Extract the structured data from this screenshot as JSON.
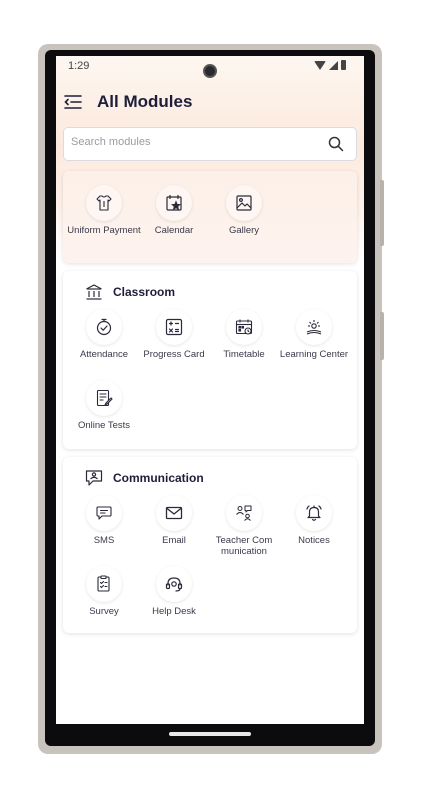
{
  "status_bar": {
    "time": "1:29"
  },
  "app_bar": {
    "title": "All Modules"
  },
  "search": {
    "placeholder": "Search modules",
    "value": ""
  },
  "quick_modules": [
    {
      "label": "Uniform Payment",
      "icon": "tshirt-icon"
    },
    {
      "label": "Calendar",
      "icon": "calendar-star-icon"
    },
    {
      "label": "Gallery",
      "icon": "image-icon"
    }
  ],
  "classroom": {
    "title": "Classroom",
    "icon": "classroom-icon",
    "modules": [
      {
        "label": "Attendance",
        "icon": "attendance-check-icon"
      },
      {
        "label": "Progress Card",
        "icon": "calculator-icon"
      },
      {
        "label": "Timetable",
        "icon": "timetable-icon"
      },
      {
        "label": "Learning Center",
        "icon": "learning-center-icon"
      },
      {
        "label": "Online Tests",
        "icon": "online-test-icon"
      }
    ]
  },
  "communication": {
    "title": "Communication",
    "icon": "communication-icon",
    "modules": [
      {
        "label": "SMS",
        "icon": "sms-icon"
      },
      {
        "label": "Email",
        "icon": "email-icon"
      },
      {
        "label": "Teacher Com munication",
        "icon": "teacher-communication-icon"
      },
      {
        "label": "Notices",
        "icon": "bell-icon"
      },
      {
        "label": "Survey",
        "icon": "survey-icon"
      },
      {
        "label": "Help Desk",
        "icon": "headset-icon"
      }
    ]
  },
  "colors": {
    "accent_bg": "#fce9dd",
    "title_text": "#1e1e3a",
    "icon_stroke": "#2a2a3a"
  }
}
